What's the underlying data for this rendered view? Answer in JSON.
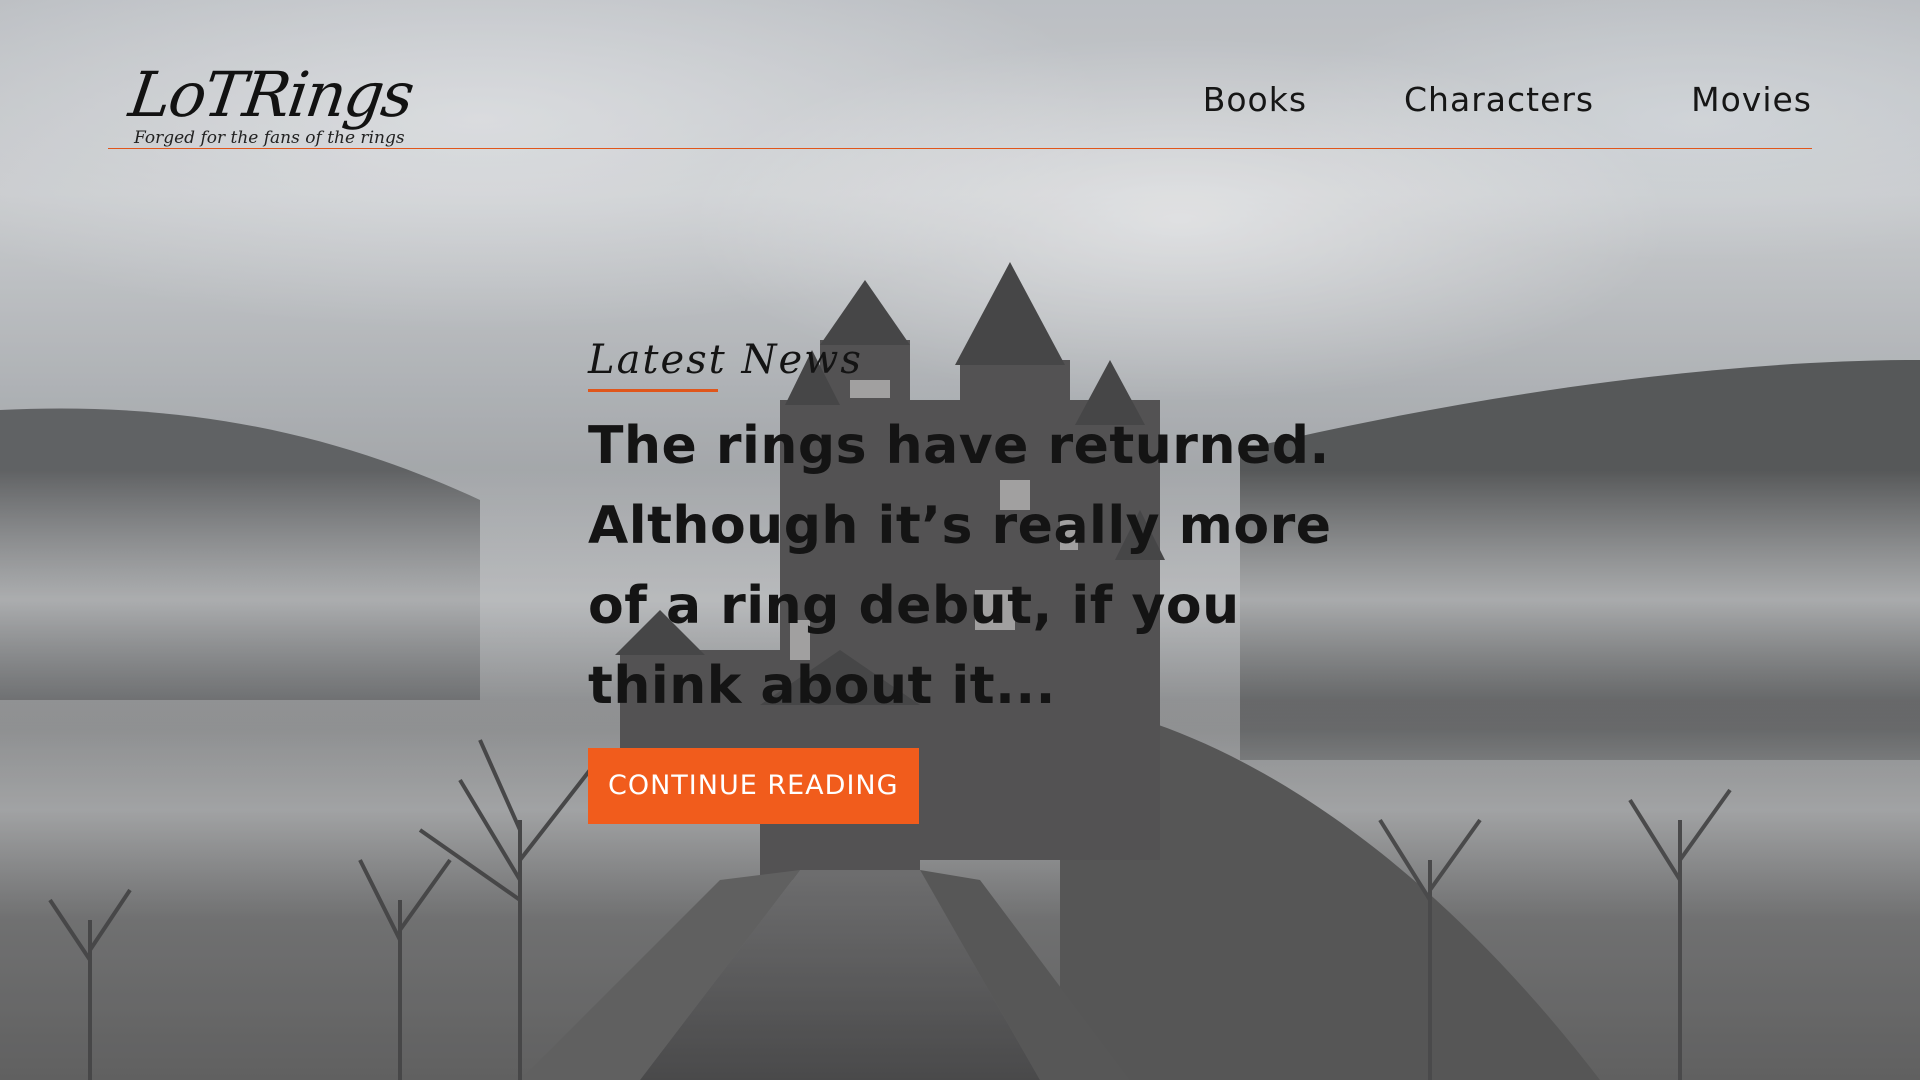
{
  "header": {
    "logo_text": "LoTRings",
    "tagline": "Forged for the fans of the rings",
    "nav": [
      {
        "label": "Books"
      },
      {
        "label": "Characters"
      },
      {
        "label": "Movies"
      }
    ]
  },
  "hero": {
    "eyebrow": "Latest News",
    "headline": "The rings have returned. Although it’s really more of a ring debut, if you think about it...",
    "cta_label": "CONTINUE READING",
    "background_image": "foggy-castle-photo"
  },
  "colors": {
    "accent": "#f15c1c",
    "rule": "#e0561b",
    "text": "#141414"
  }
}
